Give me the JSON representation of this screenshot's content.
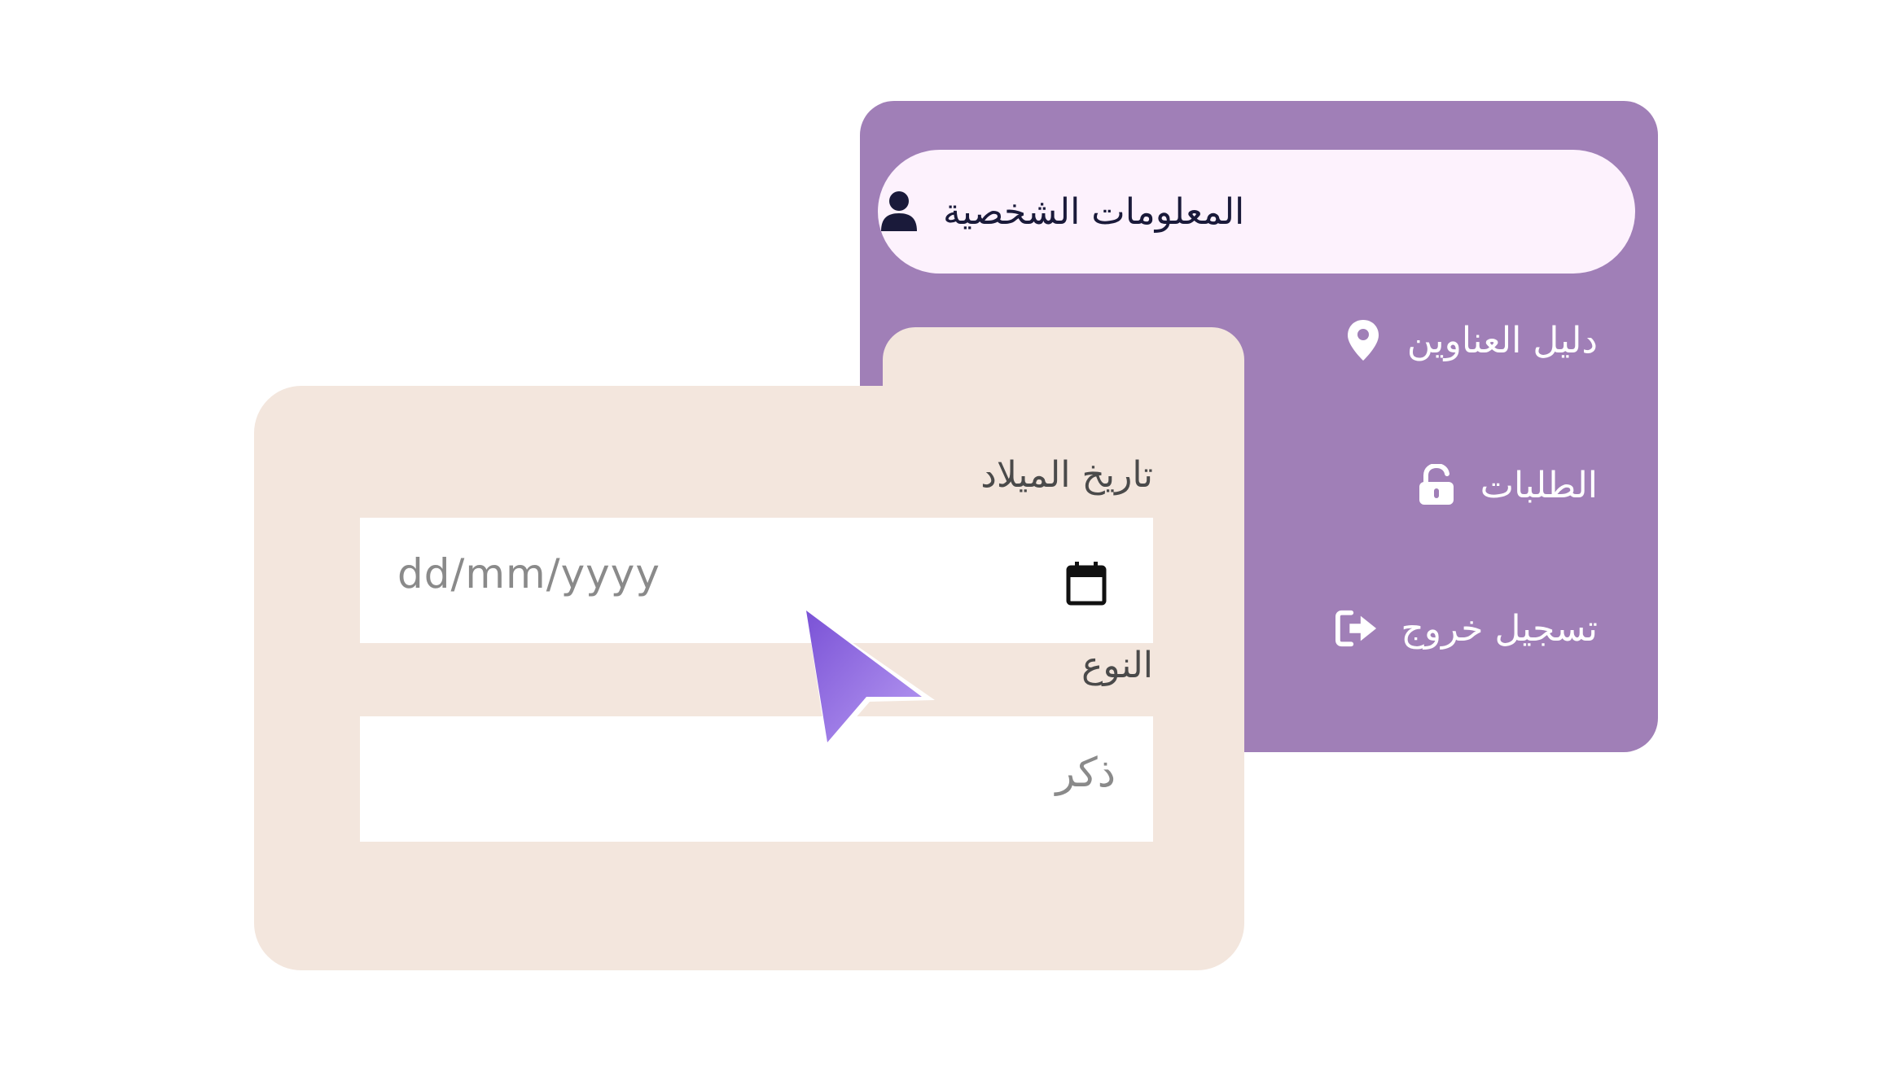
{
  "menu": {
    "items": [
      {
        "label": "المعلومات الشخصية",
        "icon": "user-icon",
        "active": true
      },
      {
        "label": "دليل العناوين",
        "icon": "map-pin-icon",
        "active": false
      },
      {
        "label": "الطلبات",
        "icon": "unlock-icon",
        "active": false
      },
      {
        "label": "تسجيل خروج",
        "icon": "sign-out-icon",
        "active": false
      }
    ],
    "panel_color": "#a07fb7",
    "active_bg": "#fdf2fd"
  },
  "form": {
    "birthdate": {
      "label": "تاريخ الميلاد",
      "placeholder": "dd/mm/yyyy",
      "icon": "calendar-icon"
    },
    "gender": {
      "label": "النوع",
      "value": "ذكر"
    },
    "card_color": "#f3e6dd"
  },
  "pointer": {
    "icon": "cursor-arrow-icon",
    "color": "#9a6ee8"
  }
}
